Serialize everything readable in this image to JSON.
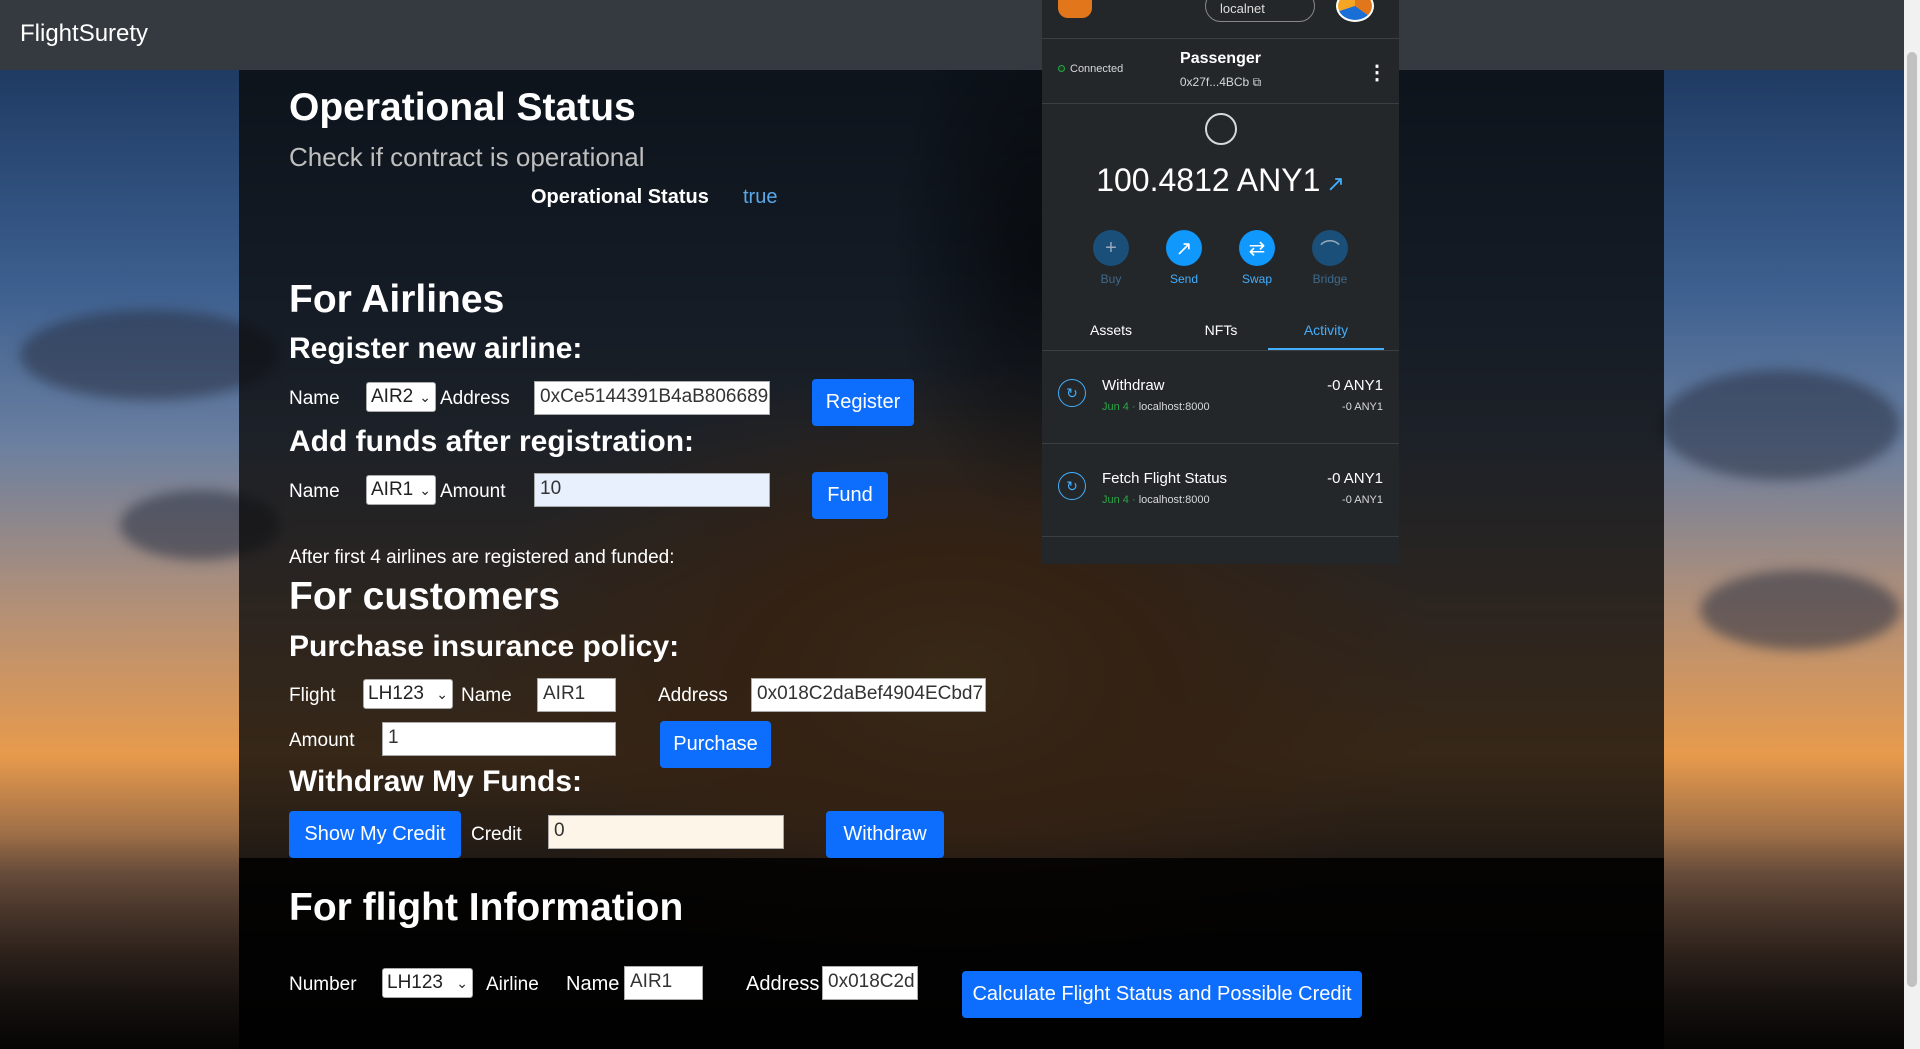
{
  "app": {
    "brand": "FlightSurety"
  },
  "operational": {
    "title": "Operational Status",
    "subtitle": "Check if contract is operational",
    "label": "Operational Status",
    "value": "true"
  },
  "airlines": {
    "title": "For Airlines",
    "register": {
      "heading": "Register new airline:",
      "name_label": "Name",
      "name_value": "AIR2",
      "address_label": "Address",
      "address_value": "0xCe5144391B4aB806689",
      "button": "Register"
    },
    "fund": {
      "heading": "Add funds after registration:",
      "name_label": "Name",
      "name_value": "AIR1",
      "amount_label": "Amount",
      "amount_value": "10",
      "button": "Fund"
    },
    "note": "After first 4 airlines are registered and funded:"
  },
  "customers": {
    "title": "For customers",
    "purchase": {
      "heading": "Purchase insurance policy:",
      "flight_label": "Flight",
      "flight_value": "LH123",
      "name_label": "Name",
      "name_value": "AIR1",
      "address_label": "Address",
      "address_value": "0x018C2daBef4904ECbd7",
      "amount_label": "Amount",
      "amount_value": "1",
      "button": "Purchase"
    },
    "withdraw": {
      "heading": "Withdraw My Funds:",
      "show_button": "Show My Credit",
      "credit_label": "Credit",
      "credit_value": "0",
      "button": "Withdraw"
    }
  },
  "flight_info": {
    "title": "For flight Information",
    "number_label": "Number",
    "number_value": "LH123",
    "airline_label": "Airline",
    "name_label": "Name",
    "name_value": "AIR1",
    "address_label": "Address",
    "address_value": "0x018C2d",
    "button": "Calculate Flight Status and Possible Credit"
  },
  "wallet": {
    "network": "localnet",
    "status": "Connected",
    "account_name": "Passenger",
    "account_address": "0x27f...4BCb",
    "balance": "100.4812 ANY1",
    "actions": [
      {
        "label": "Buy",
        "icon": "plus-icon",
        "enabled": false
      },
      {
        "label": "Send",
        "icon": "arrow-up-right-icon",
        "enabled": true
      },
      {
        "label": "Swap",
        "icon": "swap-icon",
        "enabled": true
      },
      {
        "label": "Bridge",
        "icon": "bridge-icon",
        "enabled": false
      }
    ],
    "tabs": [
      "Assets",
      "NFTs",
      "Activity"
    ],
    "active_tab": "Activity",
    "activity": [
      {
        "title": "Withdraw",
        "date": "Jun 4",
        "source": "localhost:8000",
        "amount": "-0 ANY1",
        "amount_sub": "-0 ANY1"
      },
      {
        "title": "Fetch Flight Status",
        "date": "Jun 4",
        "source": "localhost:8000",
        "amount": "-0 ANY1",
        "amount_sub": "-0 ANY1"
      }
    ]
  },
  "colors": {
    "navbar": "#343a40",
    "primary_button": "#0d6efd",
    "wallet_bg": "#24272a",
    "wallet_accent": "#43aefc",
    "status_value": "#5aa8e8"
  }
}
